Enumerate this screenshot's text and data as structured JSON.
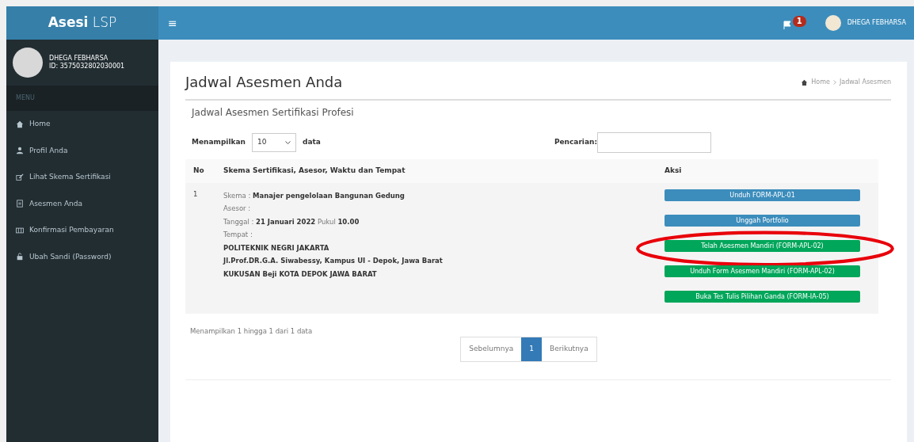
{
  "brand": {
    "bold": "Asesi",
    "light": "LSP"
  },
  "user_panel": {
    "name": "DHEGA FEBHARSA",
    "id": "ID: 3575032802030001"
  },
  "sidebar": {
    "header": "MENU",
    "items": [
      {
        "label": "Home",
        "kind": "home"
      },
      {
        "label": "Profil Anda",
        "kind": "user"
      },
      {
        "label": "Lihat Skema Sertifikasi",
        "kind": "edit"
      },
      {
        "label": "Asesmen Anda",
        "kind": "file"
      },
      {
        "label": "Konfirmasi Pembayaran",
        "kind": "card"
      },
      {
        "label": "Ubah Sandi (Password)",
        "kind": "lock"
      }
    ]
  },
  "topbar": {
    "menu_toggle": "≡",
    "notification_count": "1",
    "user_name": "DHEGA FEBHARSA"
  },
  "page": {
    "title": "Jadwal Asesmen Anda",
    "breadcrumb": [
      "Home",
      "Jadwal Asesmen"
    ]
  },
  "box": {
    "title": "Jadwal Asesmen Sertifikasi Profesi",
    "length_label": "Menampilkan",
    "length_value": "10",
    "length_suffix": "data",
    "search_label": "Pencarian:",
    "table": {
      "columns": [
        "No",
        "Skema Sertifikasi, Asesor, Waktu dan Tempat",
        "Aksi"
      ],
      "rows": [
        {
          "no": "1",
          "lines": [
            {
              "kind": "field",
              "text": "Skema : **Manajer pengelolaan Bangunan Gedung**"
            },
            {
              "kind": "field",
              "text": "Asesor :"
            },
            {
              "kind": "field",
              "text": "Tanggal : **21 Januari 2022** Pukul **10.00**"
            },
            {
              "kind": "field",
              "text": "Tempat :"
            },
            {
              "kind": "address",
              "text": "POLITEKNIK NEGRI JAKARTA"
            },
            {
              "kind": "address",
              "text": "Jl.Prof.DR.G.A. Siwabessy, Kampus UI - Depok, Jawa Barat"
            },
            {
              "kind": "address",
              "text": "KUKUSAN Beji KOTA DEPOK JAWA BARAT"
            }
          ],
          "actions": [
            {
              "label": "Unduh FORM-APL-01",
              "kind": "primary",
              "circled": false
            },
            {
              "label": "Unggah Portfolio",
              "kind": "primary",
              "circled": false
            },
            {
              "label": "Telah Asesmen Mandiri (FORM-APL-02)",
              "kind": "success",
              "circled": true
            },
            {
              "label": "Unduh Form Asesmen Mandiri (FORM-APL-02)",
              "kind": "success",
              "circled": false
            },
            {
              "label": "Buka Tes Tulis Pilihan Ganda (FORM-IA-05)",
              "kind": "success",
              "circled": false
            }
          ]
        }
      ]
    },
    "info": "Menampilkan 1 hingga 1 dari 1 data",
    "pagination": [
      {
        "label": "Sebelumnya",
        "selected": false
      },
      {
        "label": "1",
        "selected": true
      },
      {
        "label": "Berikutnya",
        "selected": false
      }
    ]
  }
}
